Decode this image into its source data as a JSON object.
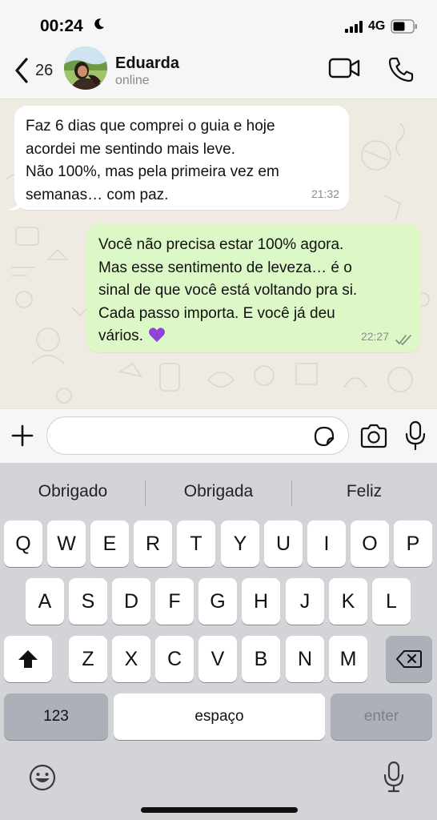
{
  "status_bar": {
    "time": "00:24",
    "network": "4G",
    "icons": [
      "moon-icon",
      "signal-icon",
      "battery-icon"
    ]
  },
  "header": {
    "back_count": "26",
    "contact_name": "Eduarda",
    "contact_status": "online",
    "icons": [
      "back-chevron-icon",
      "avatar",
      "video-camera-icon",
      "phone-icon"
    ]
  },
  "messages": [
    {
      "direction": "incoming",
      "lines": [
        "Faz 6 dias que comprei o guia e hoje",
        "acordei me sentindo mais leve.",
        "Não 100%, mas pela primeira vez em",
        "semanas… com paz."
      ],
      "time": "21:32"
    },
    {
      "direction": "outgoing",
      "lines": [
        "Você não precisa estar 100% agora.",
        "Mas esse sentimento de leveza… é o",
        "sinal de que você está voltando pra si.",
        "Cada passo importa. E você já deu",
        "vários."
      ],
      "emoji": "purple-heart-icon",
      "time": "22:27",
      "status_icon": "double-check-icon"
    }
  ],
  "composer": {
    "input_value": "",
    "input_placeholder": "",
    "icons": [
      "plus-icon",
      "sticker-icon",
      "camera-icon",
      "microphone-icon"
    ]
  },
  "keyboard": {
    "suggestions": [
      "Obrigado",
      "Obrigada",
      "Feliz"
    ],
    "row1": [
      "Q",
      "W",
      "E",
      "R",
      "T",
      "Y",
      "U",
      "I",
      "O",
      "P"
    ],
    "row2": [
      "A",
      "S",
      "D",
      "F",
      "G",
      "H",
      "J",
      "K",
      "L"
    ],
    "row3": [
      "Z",
      "X",
      "C",
      "V",
      "B",
      "N",
      "M"
    ],
    "numbers_key": "123",
    "space_key": "espaço",
    "enter_key": "enter",
    "icons": [
      "shift-icon",
      "backspace-icon",
      "emoji-icon",
      "dictation-icon"
    ]
  },
  "colors": {
    "incoming_bubble": "#ffffff",
    "outgoing_bubble": "#dcf8c6",
    "chat_background": "#efeae2",
    "keyboard_background": "#d2d4d8",
    "heart": "#8e44d6"
  }
}
